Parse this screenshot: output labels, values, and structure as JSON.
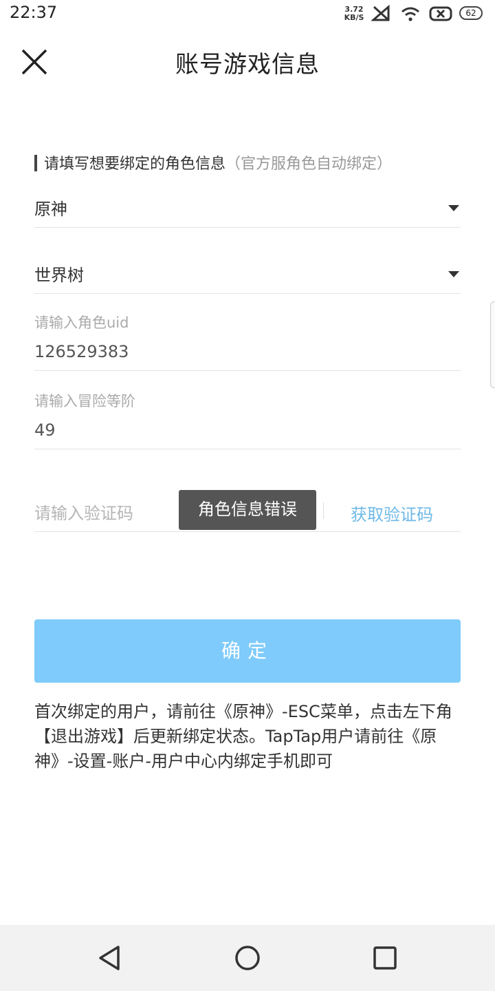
{
  "status_bar": {
    "time": "22:37",
    "net_speed_value": "3.72",
    "net_speed_unit": "KB/S",
    "battery": "62"
  },
  "header": {
    "title": "账号游戏信息"
  },
  "form": {
    "section_label": "请填写想要绑定的角色信息",
    "section_note": "（官方服角色自动绑定）",
    "game_select": "原神",
    "server_select": "世界树",
    "uid_label": "请输入角色uid",
    "uid_value": "126529383",
    "level_label": "请输入冒险等阶",
    "level_value": "49",
    "code_placeholder": "请输入验证码",
    "get_code_label": "获取验证码",
    "confirm_label": "确定"
  },
  "toast": {
    "message": "角色信息错误"
  },
  "notice": {
    "text": "首次绑定的用户，请前往《原神》-ESC菜单，点击左下角【退出游戏】后更新绑定状态。TapTap用户请前往《原神》-设置-账户-用户中心内绑定手机即可"
  },
  "icons": {
    "close": "close-icon",
    "back": "back-triangle-icon",
    "home": "home-circle-icon",
    "recents": "recents-square-icon"
  },
  "colors": {
    "accent": "#7fcbfb",
    "link": "#6fb9e6",
    "toast_bg": "#555555",
    "navbar_bg": "#f2f2f2"
  }
}
